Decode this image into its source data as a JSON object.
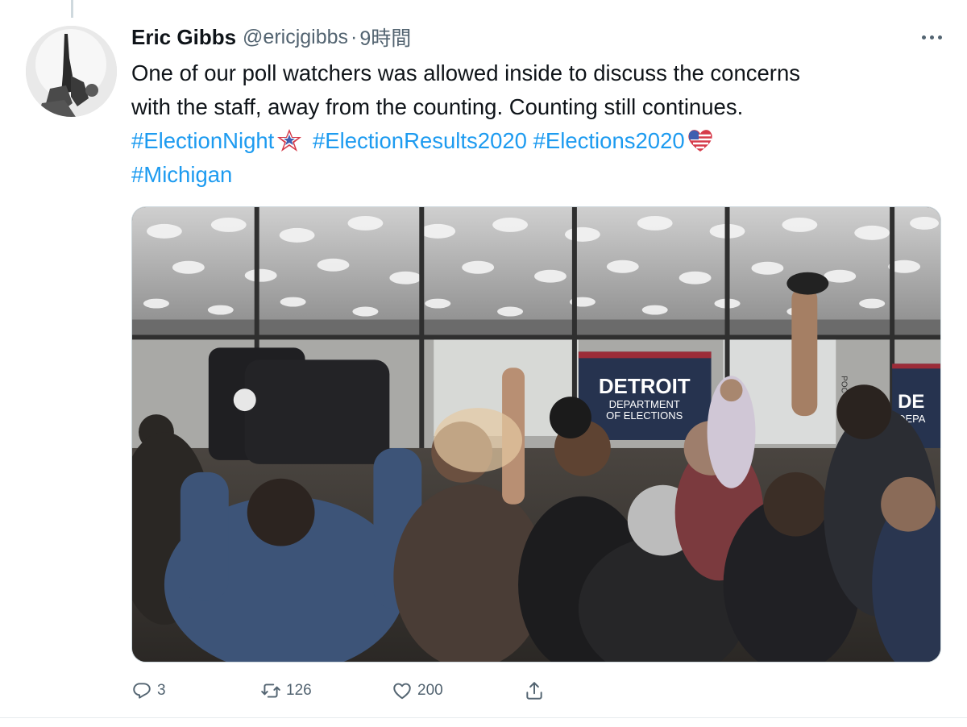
{
  "tweet": {
    "author": {
      "display_name": "Eric Gibbs",
      "handle": "@ericjgibbs",
      "separator": "·",
      "time": "9時間"
    },
    "text": {
      "line1": "One of our poll watchers was allowed inside to discuss the concerns",
      "line2": "with the staff, away from the counting. Counting still continues.",
      "hashtags": [
        "#ElectionNight",
        "#ElectionResults2020",
        "#Elections2020",
        "#Michigan"
      ]
    },
    "media": {
      "banner_left": {
        "line1": "DETROIT",
        "line2": "DEPARTMENT",
        "line3": "OF ELECTIONS"
      },
      "banner_right": {
        "line1": "DE",
        "line2": "DEPA"
      },
      "window_letters": "POC"
    },
    "actions": {
      "reply": {
        "icon": "reply-icon",
        "count": "3"
      },
      "retweet": {
        "icon": "retweet-icon",
        "count": "126"
      },
      "like": {
        "icon": "heart-icon",
        "count": "200"
      },
      "share": {
        "icon": "share-icon"
      }
    }
  },
  "colors": {
    "link": "#1d9bf0",
    "secondary_text": "#536471",
    "primary_text": "#0f1419",
    "banner_navy": "#26334f"
  }
}
